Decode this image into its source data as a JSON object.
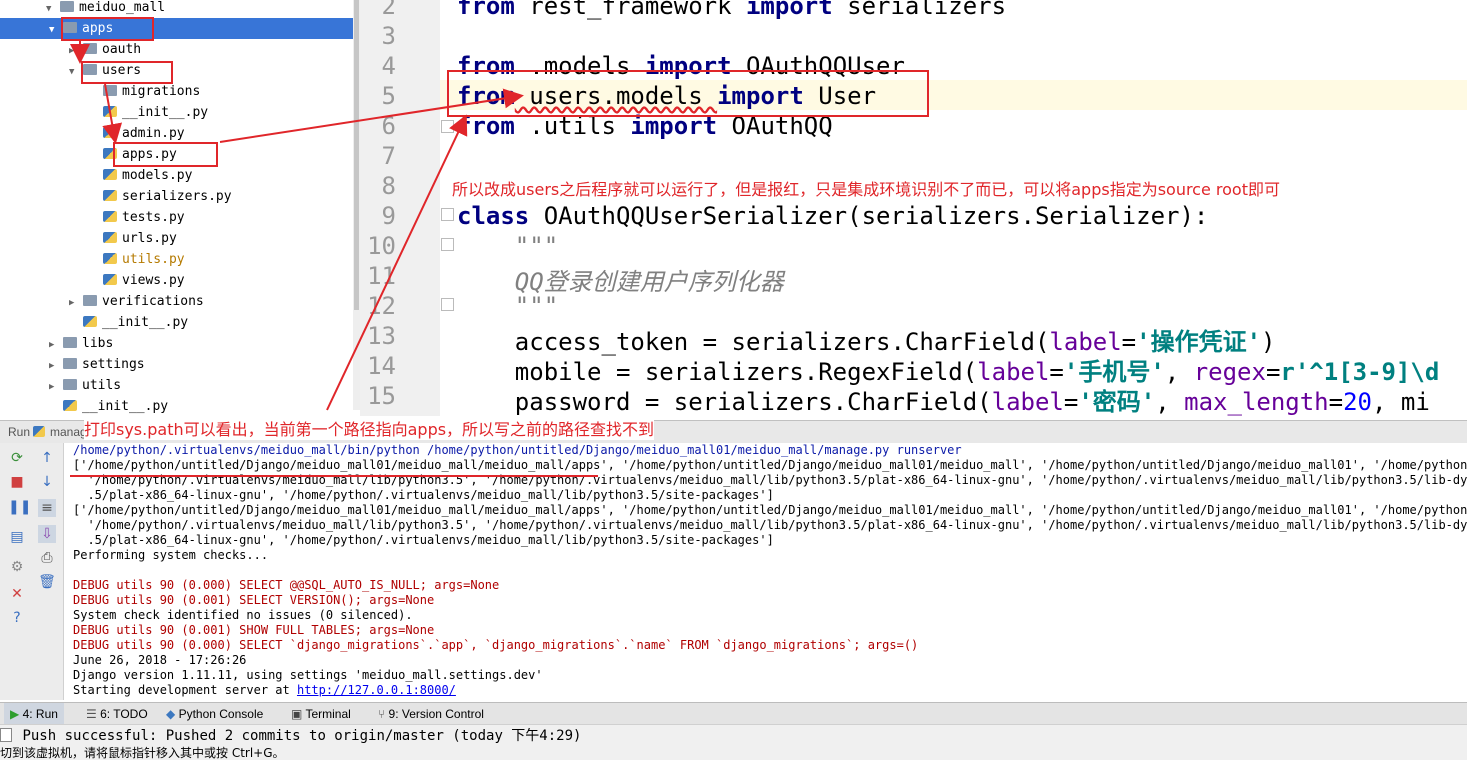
{
  "project_tree": {
    "items": [
      {
        "label": "meiduo_mall",
        "icon": "folder-icon",
        "expanded": true
      },
      {
        "label": "apps",
        "icon": "folder-icon",
        "expanded": true,
        "selected": true
      },
      {
        "label": "oauth",
        "icon": "folder-icon",
        "expanded": false
      },
      {
        "label": "users",
        "icon": "folder-icon",
        "expanded": true
      },
      {
        "label": "migrations",
        "icon": "folder-icon"
      },
      {
        "label": "__init__.py",
        "icon": "python-file-icon"
      },
      {
        "label": "admin.py",
        "icon": "python-file-icon"
      },
      {
        "label": "apps.py",
        "icon": "python-file-icon"
      },
      {
        "label": "models.py",
        "icon": "python-file-icon"
      },
      {
        "label": "serializers.py",
        "icon": "python-file-icon"
      },
      {
        "label": "tests.py",
        "icon": "python-file-icon"
      },
      {
        "label": "urls.py",
        "icon": "python-file-icon"
      },
      {
        "label": "utils.py",
        "icon": "python-file-icon",
        "modified": true
      },
      {
        "label": "views.py",
        "icon": "python-file-icon"
      },
      {
        "label": "verifications",
        "icon": "folder-icon",
        "expanded": false
      },
      {
        "label": "__init__.py",
        "icon": "python-file-icon"
      },
      {
        "label": "libs",
        "icon": "folder-icon",
        "expanded": false
      },
      {
        "label": "settings",
        "icon": "folder-icon",
        "expanded": false
      },
      {
        "label": "utils",
        "icon": "folder-icon",
        "expanded": false
      },
      {
        "label": "__init__.py",
        "icon": "python-file-icon"
      }
    ]
  },
  "editor": {
    "line_numbers": [
      "2",
      "3",
      "4",
      "5",
      "6",
      "7",
      "8",
      "9",
      "10",
      "11",
      "12",
      "13",
      "14",
      "15"
    ],
    "lines": {
      "l2": {
        "kw1": "from",
        "t1": " rest_framework ",
        "kw2": "import",
        "t2": " serializers"
      },
      "l4": {
        "kw1": "from",
        "t1": " .models ",
        "kw2": "import",
        "t2": " OAuthQQUser"
      },
      "l5": {
        "kw1": "from",
        "t1": " users.models ",
        "kw2": "import",
        "t2": " User"
      },
      "l6": {
        "kw1": "from",
        "t1": " .utils ",
        "kw2": "import",
        "t2": " OAuthQQ"
      },
      "l9": {
        "kw1": "class",
        "t1": " OAuthQQUserSerializer(serializers.Serializer):"
      },
      "l10": "    \"\"\"",
      "l11": "    QQ登录创建用户序列化器",
      "l12": "    \"\"\"",
      "l13": {
        "t1": "    access_token = serializers.CharField(",
        "a1": "label",
        "t2": "=",
        "s1": "'操作凭证'",
        "t3": ")"
      },
      "l14": {
        "t1": "    mobile = serializers.RegexField(",
        "a1": "label",
        "t2": "=",
        "s1": "'手机号'",
        "t3": ", ",
        "a2": "regex",
        "t4": "=",
        "s2": "r'^1[3-9]\\d"
      },
      "l15": {
        "t1": "    password = serializers.CharField(",
        "a1": "label",
        "t2": "=",
        "s1": "'密码'",
        "t3": ", ",
        "a2": "max_length",
        "t4": "=",
        "n1": "20",
        "t5": ", mi"
      }
    }
  },
  "annotations": {
    "note_editor": "所以改成users之后程序就可以运行了，但是报红，只是集成环境识别不了而已，可以将apps指定为source root即可",
    "note_console": "打印sys.path可以看出，当前第一个路径指向apps，所以写之前的路径查找不到"
  },
  "run_panel": {
    "tab_label": "Run",
    "tab_name": "manage",
    "console_lines": [
      {
        "text": "/home/python/.virtualenvs/meiduo_mall/bin/python /home/python/untitled/Django/meiduo_mall01/meiduo_mall/manage.py runserver",
        "style": "blue"
      },
      {
        "text": "['/home/python/untitled/Django/meiduo_mall01/meiduo_mall/meiduo_mall/apps', '/home/python/untitled/Django/meiduo_mall01/meiduo_mall', '/home/python/untitled/Django/meiduo_mall01', '/home/python/.virt",
        "style": "black"
      },
      {
        "text": "  '/home/python/.virtualenvs/meiduo_mall/lib/python3.5', '/home/python/.virtualenvs/meiduo_mall/lib/python3.5/plat-x86_64-linux-gnu', '/home/python/.virtualenvs/meiduo_mall/lib/python3.5/lib-dynload', '/h",
        "style": "black"
      },
      {
        "text": "  .5/plat-x86_64-linux-gnu', '/home/python/.virtualenvs/meiduo_mall/lib/python3.5/site-packages']",
        "style": "black"
      },
      {
        "text": "['/home/python/untitled/Django/meiduo_mall01/meiduo_mall/meiduo_mall/apps', '/home/python/untitled/Django/meiduo_mall01/meiduo_mall', '/home/python/untitled/Django/meiduo_mall01', '/home/python/.virt",
        "style": "black"
      },
      {
        "text": "  '/home/python/.virtualenvs/meiduo_mall/lib/python3.5', '/home/python/.virtualenvs/meiduo_mall/lib/python3.5/plat-x86_64-linux-gnu', '/home/python/.virtualenvs/meiduo_mall/lib/python3.5/lib-dynload', '/h",
        "style": "black"
      },
      {
        "text": "  .5/plat-x86_64-linux-gnu', '/home/python/.virtualenvs/meiduo_mall/lib/python3.5/site-packages']",
        "style": "black"
      },
      {
        "text": "Performing system checks...",
        "style": "black"
      },
      {
        "text": "",
        "style": "black"
      },
      {
        "text": "DEBUG utils 90 (0.000) SELECT @@SQL_AUTO_IS_NULL; args=None",
        "style": "red"
      },
      {
        "text": "DEBUG utils 90 (0.001) SELECT VERSION(); args=None",
        "style": "red"
      },
      {
        "text": "System check identified no issues (0 silenced).",
        "style": "black"
      },
      {
        "text": "DEBUG utils 90 (0.001) SHOW FULL TABLES; args=None",
        "style": "red"
      },
      {
        "text": "DEBUG utils 90 (0.000) SELECT `django_migrations`.`app`, `django_migrations`.`name` FROM `django_migrations`; args=()",
        "style": "red"
      },
      {
        "text": "June 26, 2018 - 17:26:26",
        "style": "black"
      },
      {
        "text": "Django version 1.11.11, using settings 'meiduo_mall.settings.dev'",
        "style": "black"
      },
      {
        "text": "Starting development server at ",
        "style": "black",
        "link": "http://127.0.0.1:8000/"
      }
    ]
  },
  "tool_tabs": [
    {
      "label": "4: Run",
      "icon": "run-icon",
      "active": true
    },
    {
      "label": "6: TODO",
      "icon": "todo-icon"
    },
    {
      "label": "Python Console",
      "icon": "python-console-icon"
    },
    {
      "label": "Terminal",
      "icon": "terminal-icon"
    },
    {
      "label": "9: Version Control",
      "icon": "version-control-icon"
    }
  ],
  "status_bar": {
    "message": "Push successful: Pushed 2 commits to origin/master (today 下午4:29)"
  },
  "hint_bar": {
    "message": "切到该虚拟机，请将鼠标指针移入其中或按 Ctrl+G。"
  },
  "colors": {
    "selection": "#3875d7",
    "annotation_red": "#e0262a",
    "keyword": "#000080",
    "string": "#008080"
  }
}
